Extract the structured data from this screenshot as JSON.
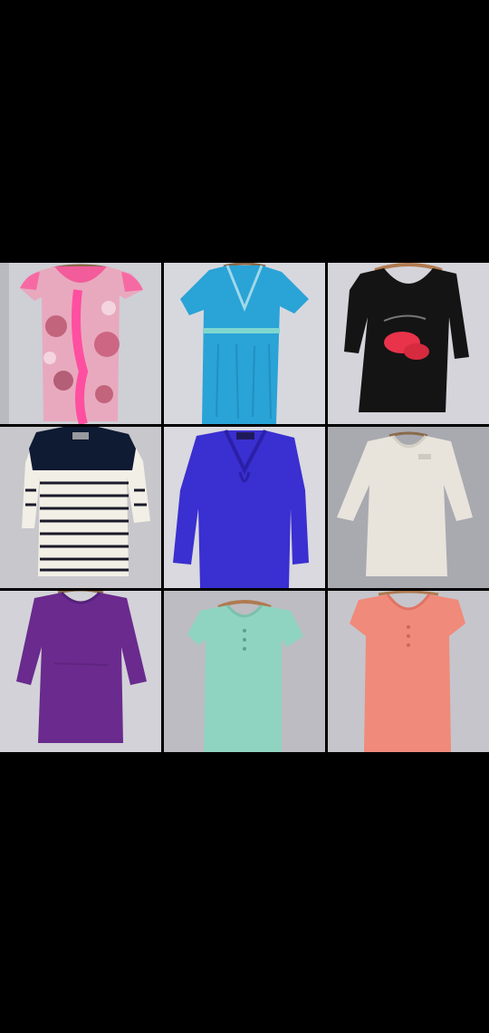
{
  "photo": {
    "description_free": true,
    "garments": [
      {
        "name": "pink-paisley-ruffle-blouse",
        "color": "#e85a97",
        "pattern": "paisley",
        "wall": "#cfcfd6"
      },
      {
        "name": "turquoise-crinkle-top",
        "color": "#2aa3d6",
        "pattern": "plain",
        "wall": "#d7d8de"
      },
      {
        "name": "black-lips-print-top",
        "color": "#141414",
        "pattern": "lips",
        "wall": "#d4d4da"
      },
      {
        "name": "navy-white-striped-top",
        "color": "#0f1a33",
        "pattern": "stripes",
        "wall": "#c8c7cc"
      },
      {
        "name": "royal-blue-long-sleeve-top",
        "color": "#3a2fd0",
        "pattern": "plain",
        "wall": "#d9d9df"
      },
      {
        "name": "ivory-three-quarter-sleeve-top",
        "color": "#e8e4dc",
        "pattern": "plain",
        "wall": "#a9a9b0"
      },
      {
        "name": "purple-three-quarter-sleeve-top",
        "color": "#6a2a8e",
        "pattern": "plain",
        "wall": "#d2d2d8"
      },
      {
        "name": "mint-henley-tee",
        "color": "#8fd4c0",
        "pattern": "plain",
        "wall": "#bdbcc2"
      },
      {
        "name": "coral-henley-tee",
        "color": "#f08a7a",
        "pattern": "plain",
        "wall": "#c6c5cb"
      }
    ]
  }
}
